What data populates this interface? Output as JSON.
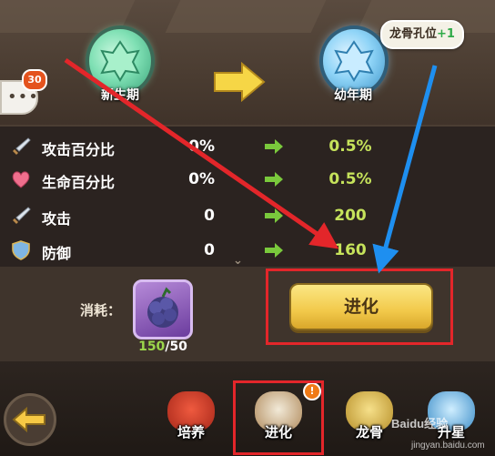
{
  "header": {
    "current_stage": "新生期",
    "next_stage": "幼年期",
    "tooltip_text": "龙骨孔位",
    "tooltip_bonus": "+1",
    "chat_badge": "30"
  },
  "stats": [
    {
      "icon": "sword-icon",
      "name": "攻击百分比",
      "current": "0%",
      "next": "0.5%"
    },
    {
      "icon": "heart-icon",
      "name": "生命百分比",
      "current": "0%",
      "next": "0.5%"
    },
    {
      "icon": "sword-icon",
      "name": "攻击",
      "current": "0",
      "next": "200"
    },
    {
      "icon": "shield-icon",
      "name": "防御",
      "current": "0",
      "next": "160"
    }
  ],
  "cost": {
    "label": "消耗：",
    "item_icon": "purple-fruit-icon",
    "have": "150",
    "separator": "/",
    "need": "50"
  },
  "evolve_button": "进化",
  "tabs": [
    {
      "label": "培养",
      "icon": "red-dragon-icon"
    },
    {
      "label": "进化",
      "icon": "evolve-dragon-icon"
    },
    {
      "label": "龙骨",
      "icon": "dragon-bone-icon"
    },
    {
      "label": "升星",
      "icon": "star-up-icon"
    }
  ],
  "tab_notice": "!",
  "watermark": {
    "text": "Baidu经验",
    "sub": "jingyan.baidu.com"
  },
  "colors": {
    "next_value": "#c6e35b",
    "highlight": "#e3262a",
    "button": "#f2c94a",
    "arrow_red": "#e3262a",
    "arrow_blue": "#1e8ff0"
  }
}
